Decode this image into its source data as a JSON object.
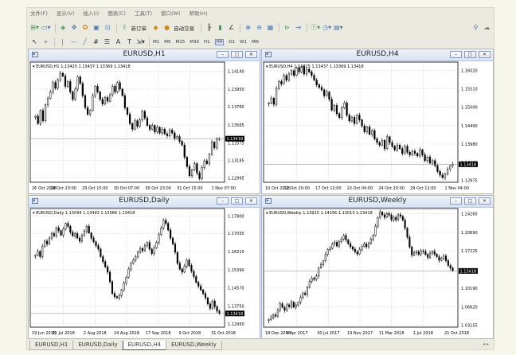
{
  "menu": [
    "文件(F)",
    "显示(V)",
    "插入(I)",
    "图表(C)",
    "工具(T)",
    "窗口(W)",
    "帮助(H)"
  ],
  "toolbar": {
    "new_order_label": "新订单",
    "autotrade_label": "自动交易"
  },
  "timeframes": [
    "M1",
    "M5",
    "M15",
    "M30",
    "H1",
    "H4",
    "D1",
    "W1",
    "MN"
  ],
  "active_timeframe": "H4",
  "colors": {
    "bull_candle": "#000000",
    "bear_candle": "#000000",
    "grid": "#c0c0c0",
    "price_tag_bg": "#000000",
    "price_tag_text": "#ffffff"
  },
  "windows": [
    {
      "title": "EURUSD,H1",
      "info": "EURUSD,H1  1.13425 1.13437 1.13369 1.13418"
    },
    {
      "title": "EURUSD,H4",
      "info": "EURUSD,H4  1.13425 1.13437 1.13369 1.13418"
    },
    {
      "title": "EURUSD,Daily",
      "info": "EURUSD,Daily  1.13094 1.13493 1.13066 1.13418"
    },
    {
      "title": "EURUSD,Weekly",
      "info": "EURUSD,Weekly  1.13915 1.14156 1.13013 1.13418"
    }
  ],
  "tabs": [
    "EURUSD,H1",
    "EURUSD,Daily",
    "EURUSD,H4",
    "EURUSD,Weekly"
  ],
  "active_tab": "EURUSD,H4",
  "chart_data": [
    {
      "type": "candlestick",
      "title": "EURUSD,H1",
      "current_price": "1.13418",
      "y_ticks": [
        "1.14140",
        "1.13950",
        "1.13760",
        "1.13565",
        "1.13375",
        "1.13185",
        "1.12995"
      ],
      "y_range": [
        1.1295,
        1.1424
      ],
      "x_ticks": [
        "26 Oct 2018",
        "26 Oct 23:00",
        "29 Oct 15:00",
        "30 Oct 07:00",
        "30 Oct 23:00",
        "31 Oct 15:00",
        "1 Nov 07:00"
      ],
      "closes": [
        1.1366,
        1.1358,
        1.1372,
        1.1361,
        1.1378,
        1.1385,
        1.1392,
        1.1402,
        1.1396,
        1.1405,
        1.1412,
        1.1409,
        1.1398,
        1.1403,
        1.1392,
        1.1384,
        1.1395,
        1.1408,
        1.1401,
        1.1388,
        1.1375,
        1.1368,
        1.1372,
        1.1388,
        1.1398,
        1.1392,
        1.1384,
        1.1379,
        1.1386,
        1.1382,
        1.1389,
        1.1398,
        1.1392,
        1.1402,
        1.1395,
        1.1388,
        1.1375,
        1.1368,
        1.1358,
        1.1352,
        1.1361,
        1.1355,
        1.1362,
        1.1371,
        1.1364,
        1.1356,
        1.1352,
        1.1356,
        1.1349,
        1.1354,
        1.1348,
        1.1352,
        1.1347,
        1.1345,
        1.1351,
        1.1348,
        1.1342,
        1.1344,
        1.1339,
        1.1335,
        1.1322,
        1.1312,
        1.1302,
        1.1308,
        1.1315,
        1.1305,
        1.1299,
        1.1311,
        1.1318,
        1.1315,
        1.1325,
        1.1338,
        1.1332,
        1.1341,
        1.1342
      ]
    },
    {
      "type": "candlestick",
      "title": "EURUSD,H4",
      "current_price": "1.13418",
      "y_ticks": [
        "1.16020",
        "1.15510",
        "1.15000",
        "1.14490",
        "1.13980",
        "1.13470",
        "1.12975"
      ],
      "y_range": [
        1.1292,
        1.1625
      ],
      "x_ticks": [
        "10 Oct 2018",
        "12 Oct 20:00",
        "17 Oct 12:00",
        "22 Oct 04:00",
        "24 Oct 20:00",
        "29 Oct 12:00",
        "1 Nov 04:00"
      ],
      "closes": [
        1.1512,
        1.1525,
        1.1508,
        1.1552,
        1.1571,
        1.1565,
        1.1588,
        1.1575,
        1.1592,
        1.1601,
        1.1588,
        1.1609,
        1.1598,
        1.1612,
        1.1592,
        1.1605,
        1.1598,
        1.1588,
        1.1575,
        1.1562,
        1.1555,
        1.1548,
        1.1532,
        1.1542,
        1.1522,
        1.1492,
        1.1505,
        1.1482,
        1.1471,
        1.1498,
        1.1512,
        1.1478,
        1.1462,
        1.1472,
        1.1455,
        1.1478,
        1.1465,
        1.1448,
        1.1432,
        1.1445,
        1.1425,
        1.1435,
        1.1412,
        1.1402,
        1.1395,
        1.1408,
        1.1385,
        1.1418,
        1.1402,
        1.1392,
        1.1382,
        1.1395,
        1.1385,
        1.1372,
        1.1392,
        1.1375,
        1.1368,
        1.1378,
        1.1372,
        1.1365,
        1.1382,
        1.1368,
        1.1352,
        1.1362,
        1.1345,
        1.1352,
        1.1338,
        1.1322,
        1.1312,
        1.1305,
        1.1315,
        1.1328,
        1.1338,
        1.1342
      ]
    },
    {
      "type": "candlestick",
      "title": "EURUSD,Daily",
      "current_price": "1.13418",
      "y_ticks": [
        "1.17800",
        "1.17030",
        "1.16210",
        "1.15390",
        "1.14570",
        "1.13750",
        "1.12950"
      ],
      "y_range": [
        1.128,
        1.1815
      ],
      "x_ticks": [
        "19 Jun 2018",
        "11 Jul 2018",
        "2 Aug 2018",
        "24 Aug 2018",
        "17 Sep 2018",
        "9 Oct 2018",
        "31 Oct 2018"
      ],
      "closes": [
        1.1605,
        1.1622,
        1.1598,
        1.1645,
        1.1668,
        1.1655,
        1.1682,
        1.1702,
        1.1692,
        1.1728,
        1.1715,
        1.1695,
        1.1722,
        1.1748,
        1.1735,
        1.1708,
        1.1692,
        1.1702,
        1.1682,
        1.1668,
        1.1695,
        1.1712,
        1.1735,
        1.1705,
        1.1682,
        1.1665,
        1.1648,
        1.1632,
        1.1598,
        1.1575,
        1.1552,
        1.1528,
        1.1485,
        1.1432,
        1.1418,
        1.1412,
        1.1422,
        1.1448,
        1.1478,
        1.1505,
        1.1542,
        1.1568,
        1.1582,
        1.1598,
        1.1618,
        1.1635,
        1.1625,
        1.1648,
        1.1662,
        1.1632,
        1.1612,
        1.1638,
        1.1662,
        1.1698,
        1.1728,
        1.1762,
        1.1748,
        1.1718,
        1.1682,
        1.1655,
        1.1618,
        1.1568,
        1.1542,
        1.1528,
        1.1555,
        1.1582,
        1.1558,
        1.1532,
        1.1508,
        1.1482,
        1.1465,
        1.1448,
        1.1432,
        1.1412,
        1.1385,
        1.1365,
        1.1398,
        1.1372,
        1.1352,
        1.1342
      ]
    },
    {
      "type": "candlestick",
      "title": "EURUSD,Weekly",
      "current_price": "1.13418",
      "y_ticks": [
        "1.24260",
        "1.20690",
        "1.17225",
        "1.13418",
        "1.10190",
        "1.06620",
        "1.03155"
      ],
      "y_range": [
        1.028,
        1.252
      ],
      "x_ticks": [
        "18 Dec 2016",
        "9 Apr 2017",
        "30 Jul 2017",
        "19 Nov 2017",
        "11 Mar 2018",
        "1 Jul 2018",
        "21 Oct 2018"
      ],
      "closes": [
        1.0425,
        1.0465,
        1.0512,
        1.0488,
        1.0605,
        1.0722,
        1.0655,
        1.0598,
        1.0702,
        1.0668,
        1.0752,
        1.0658,
        1.0695,
        1.0748,
        1.0842,
        1.0922,
        1.0898,
        1.1032,
        1.1148,
        1.1205,
        1.1182,
        1.1245,
        1.1398,
        1.1462,
        1.1532,
        1.1652,
        1.1748,
        1.1768,
        1.1852,
        1.1882,
        1.1812,
        1.1892,
        1.1942,
        1.2012,
        1.1928,
        1.1852,
        1.1798,
        1.1752,
        1.1705,
        1.1662,
        1.1748,
        1.1808,
        1.1852,
        1.1798,
        1.1862,
        1.1942,
        1.2012,
        1.2188,
        1.2352,
        1.2452,
        1.2402,
        1.2355,
        1.2425,
        1.2398,
        1.2305,
        1.2355,
        1.2308,
        1.2402,
        1.2375,
        1.2302,
        1.2152,
        1.1978,
        1.1792,
        1.1642,
        1.1682,
        1.1702,
        1.1655,
        1.1722,
        1.1708,
        1.1652,
        1.1598,
        1.1678,
        1.1712,
        1.1658,
        1.1608,
        1.1542,
        1.1582,
        1.1625,
        1.1535,
        1.1445,
        1.1395,
        1.1342
      ]
    }
  ]
}
